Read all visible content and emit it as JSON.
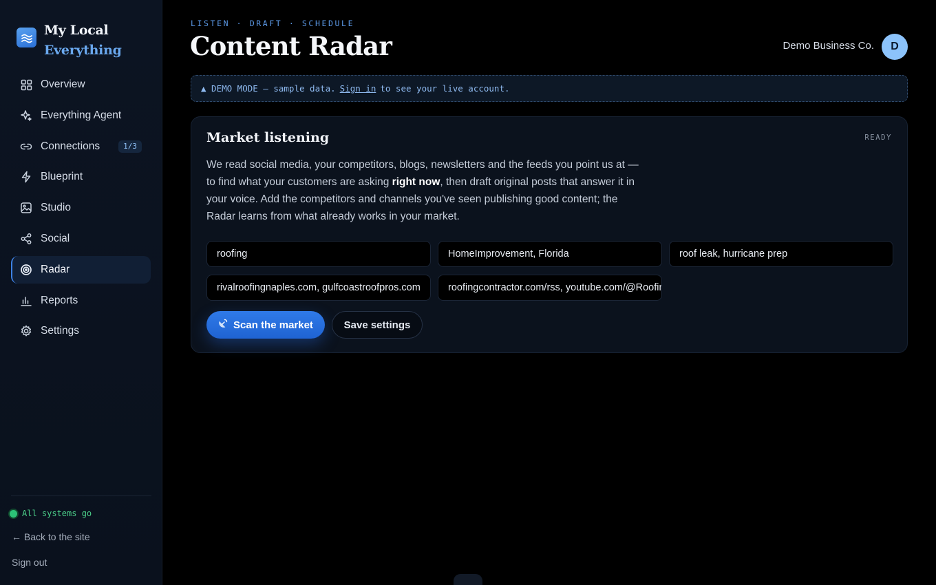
{
  "brand": {
    "line1": "My Local",
    "line2": "Everything"
  },
  "sidebar": {
    "items": [
      {
        "label": "Overview",
        "icon": "grid-icon"
      },
      {
        "label": "Everything Agent",
        "icon": "sparkle-icon"
      },
      {
        "label": "Connections",
        "icon": "link-icon",
        "badge": "1/3"
      },
      {
        "label": "Blueprint",
        "icon": "bolt-icon"
      },
      {
        "label": "Studio",
        "icon": "image-icon"
      },
      {
        "label": "Social",
        "icon": "share-icon"
      },
      {
        "label": "Radar",
        "icon": "radar-icon",
        "active": true
      },
      {
        "label": "Reports",
        "icon": "bar-chart-icon"
      },
      {
        "label": "Settings",
        "icon": "gear-icon"
      }
    ],
    "status": "All systems go",
    "back_link": "← Back to the site",
    "sign_out": "Sign out"
  },
  "header": {
    "eyebrow": "LISTEN · DRAFT · SCHEDULE",
    "title": "Content Radar",
    "business": "Demo Business Co.",
    "avatar_initial": "D"
  },
  "demo_banner": {
    "prefix": "▲ DEMO MODE — sample data.",
    "link": "Sign in",
    "suffix": "to see your live account."
  },
  "card": {
    "title": "Market listening",
    "status": "READY",
    "desc_part1": "We read social media, your competitors, blogs, newsletters and the feeds you point us at — to find what your customers are asking ",
    "desc_bold": "right now",
    "desc_part2": ", then draft original posts that answer it in your voice. Add the competitors and channels you've seen publishing good content; the Radar learns from what already works in your market.",
    "fields": {
      "industry": "roofing",
      "topics": "HomeImprovement, Florida",
      "keywords": "roof leak, hurricane prep",
      "competitors": "rivalroofingnaples.com, gulfcoastroofpros.com",
      "feeds": "roofingcontractor.com/rss, youtube.com/@RoofingChannel"
    },
    "scan_button": "Scan the market",
    "save_button": "Save settings"
  },
  "colors": {
    "accent": "#2f7ae8",
    "status_ok": "#2cc277",
    "background": "#000000"
  }
}
